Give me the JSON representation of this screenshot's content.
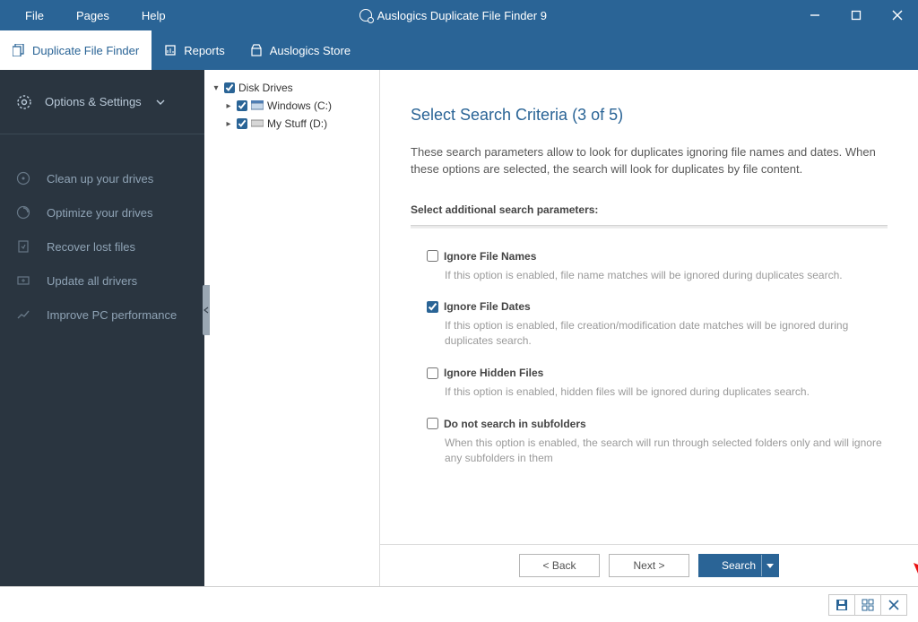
{
  "titlebar": {
    "menus": {
      "file": "File",
      "pages": "Pages",
      "help": "Help"
    },
    "app_title": "Auslogics Duplicate File Finder 9"
  },
  "tabs": {
    "dff": "Duplicate File Finder",
    "reports": "Reports",
    "store": "Auslogics Store"
  },
  "sidebar": {
    "options_label": "Options & Settings",
    "items": [
      "Clean up your drives",
      "Optimize your drives",
      "Recover lost files",
      "Update all drivers",
      "Improve PC performance"
    ]
  },
  "tree": {
    "root": "Disk Drives",
    "nodes": [
      {
        "label": "Windows (C:)"
      },
      {
        "label": "My Stuff (D:)"
      }
    ]
  },
  "wizard": {
    "title": "Select Search Criteria (3 of 5)",
    "intro": "These search parameters allow to look for duplicates ignoring file names and dates. When these options are selected, the search will look for duplicates by file content.",
    "subhead": "Select additional search parameters:",
    "options": [
      {
        "label": "Ignore File Names",
        "checked": false,
        "desc": "If this option is enabled, file name matches will be ignored during duplicates search."
      },
      {
        "label": "Ignore File Dates",
        "checked": true,
        "desc": "If this option is enabled, file creation/modification date matches will be ignored during duplicates search."
      },
      {
        "label": "Ignore Hidden Files",
        "checked": false,
        "desc": "If this option is enabled, hidden files will be ignored during duplicates search."
      },
      {
        "label": "Do not search in subfolders",
        "checked": false,
        "desc": "When this option is enabled, the search will run through selected folders only and will ignore any subfolders in them"
      }
    ],
    "buttons": {
      "back": "< Back",
      "next": "Next >",
      "search": "Search"
    }
  }
}
